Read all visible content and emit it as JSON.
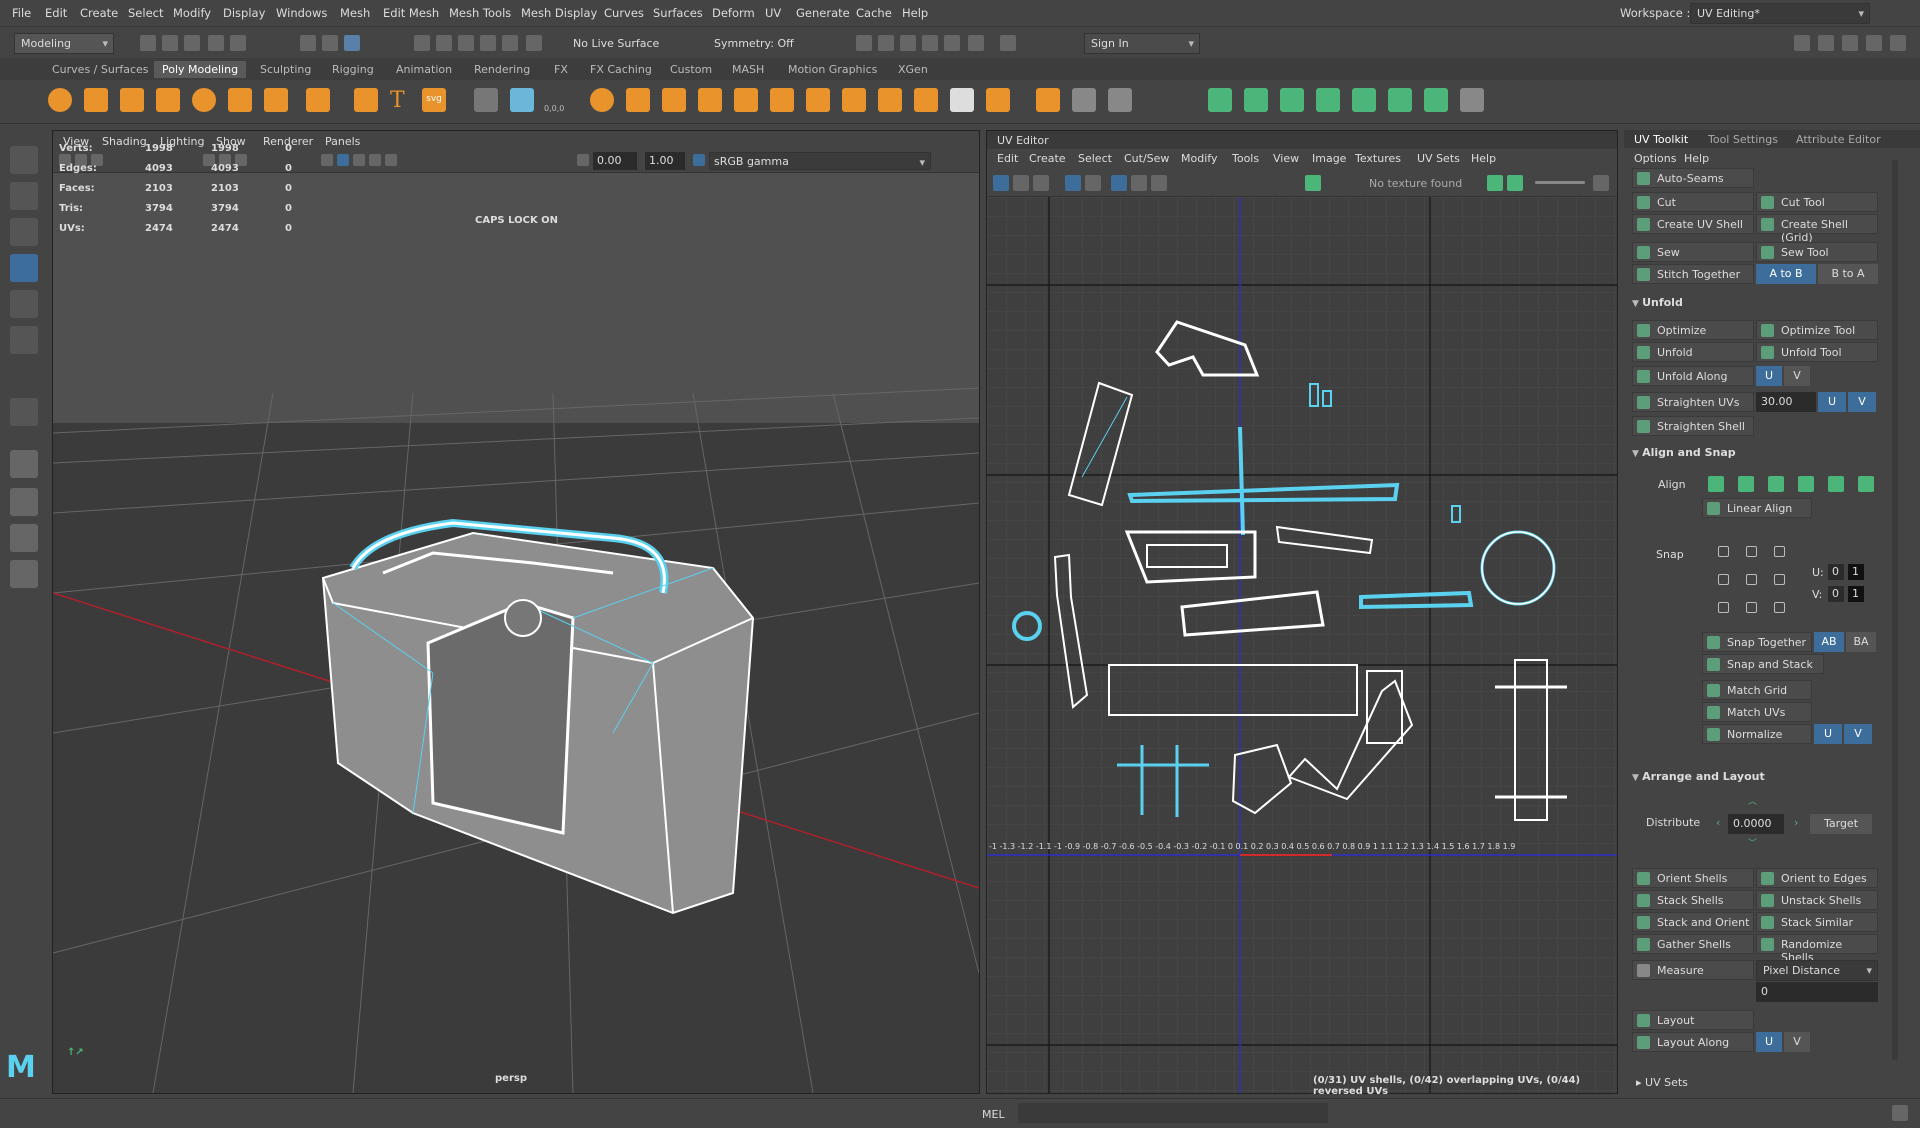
{
  "menubar": {
    "items": [
      "File",
      "Edit",
      "Create",
      "Select",
      "Modify",
      "Display",
      "Windows",
      "Mesh",
      "Edit Mesh",
      "Mesh Tools",
      "Mesh Display",
      "Curves",
      "Surfaces",
      "Deform",
      "UV",
      "Generate",
      "Cache",
      "Help"
    ],
    "workspace_label": "Workspace :",
    "workspace_value": "UV Editing*"
  },
  "statusline": {
    "mode": "Modeling",
    "live_surface": "No Live Surface",
    "symmetry": "Symmetry: Off",
    "sign_in": "Sign In"
  },
  "shelf": {
    "tabs": [
      "Curves / Surfaces",
      "Poly Modeling",
      "Sculpting",
      "Rigging",
      "Animation",
      "Rendering",
      "FX",
      "FX Caching",
      "Custom",
      "MASH",
      "Motion Graphics",
      "XGen"
    ],
    "active_tab": "Poly Modeling",
    "svg_label": "svg",
    "coord_label": "0,0,0"
  },
  "viewport": {
    "menu": [
      "View",
      "Shading",
      "Lighting",
      "Show",
      "Renderer",
      "Panels"
    ],
    "value1": "0.00",
    "value2": "1.00",
    "color_space": "sRGB gamma",
    "hud": [
      {
        "label": "Verts:",
        "a": "1998",
        "b": "1998",
        "c": "0"
      },
      {
        "label": "Edges:",
        "a": "4093",
        "b": "4093",
        "c": "0"
      },
      {
        "label": "Faces:",
        "a": "2103",
        "b": "2103",
        "c": "0"
      },
      {
        "label": "Tris:",
        "a": "3794",
        "b": "3794",
        "c": "0"
      },
      {
        "label": "UVs:",
        "a": "2474",
        "b": "2474",
        "c": "0"
      }
    ],
    "caps_lock": "CAPS LOCK ON",
    "camera": "persp"
  },
  "uv_editor": {
    "title": "UV Editor",
    "menu": [
      "Edit",
      "Create",
      "Select",
      "Cut/Sew",
      "Modify",
      "Tools",
      "View",
      "Image",
      "Textures",
      "UV Sets",
      "Help"
    ],
    "texture": "No texture found",
    "status": "(0/31) UV shells, (0/42) overlapping UVs, (0/44) reversed UVs",
    "ruler": "-1 -1.3 -1.2 -1.1 -1 -0.9 -0.8 -0.7 -0.6 -0.5 -0.4 -0.3 -0.2 -0.1 0 0.1 0.2 0.3 0.4 0.5 0.6 0.7 0.8 0.9 1 1.1 1.2 1.3 1.4 1.5 1.6 1.7 1.8 1.9"
  },
  "toolkit": {
    "tabs": [
      "UV Toolkit",
      "Tool Settings",
      "Attribute Editor"
    ],
    "submenu": [
      "Options",
      "Help"
    ],
    "auto_seams": "Auto-Seams",
    "cut": "Cut",
    "cut_tool": "Cut Tool",
    "create_uv_shell": "Create UV Shell",
    "create_shell_grid": "Create Shell (Grid)",
    "sew": "Sew",
    "sew_tool": "Sew Tool",
    "stitch_together": "Stitch Together",
    "a_to_b": "A to B",
    "b_to_a": "B to A",
    "unfold_section": "Unfold",
    "optimize": "Optimize",
    "optimize_tool": "Optimize Tool",
    "unfold": "Unfold",
    "unfold_tool": "Unfold Tool",
    "unfold_along": "Unfold Along",
    "u": "U",
    "v": "V",
    "straighten_uvs": "Straighten UVs",
    "straighten_value": "30.00",
    "straighten_shell": "Straighten Shell",
    "align_section": "Align and Snap",
    "align": "Align",
    "linear_align": "Linear Align",
    "snap": "Snap",
    "u_label": "U:",
    "v_label": "V:",
    "zero": "0",
    "one": "1",
    "snap_together": "Snap Together",
    "ab": "AB",
    "ba": "BA",
    "snap_and_stack": "Snap and Stack",
    "match_grid": "Match Grid",
    "match_uvs": "Match UVs",
    "normalize": "Normalize",
    "arrange_section": "Arrange and Layout",
    "distribute": "Distribute",
    "distribute_value": "0.0000",
    "target": "Target",
    "orient_shells": "Orient Shells",
    "orient_to_edges": "Orient to Edges",
    "stack_shells": "Stack Shells",
    "unstack_shells": "Unstack Shells",
    "stack_and_orient": "Stack and Orient",
    "stack_similar": "Stack Similar",
    "gather_shells": "Gather Shells",
    "randomize_shells": "Randomize Shells",
    "measure": "Measure",
    "pixel_distance": "Pixel Distance",
    "measure_value": "0",
    "layout": "Layout",
    "layout_along": "Layout Along",
    "uv_sets": "UV Sets"
  },
  "cmdline": {
    "label": "MEL"
  },
  "colors": {
    "accent": "#5bd1f0",
    "blue_btn": "#3d6d9a",
    "icon_orange": "#e8932c"
  }
}
